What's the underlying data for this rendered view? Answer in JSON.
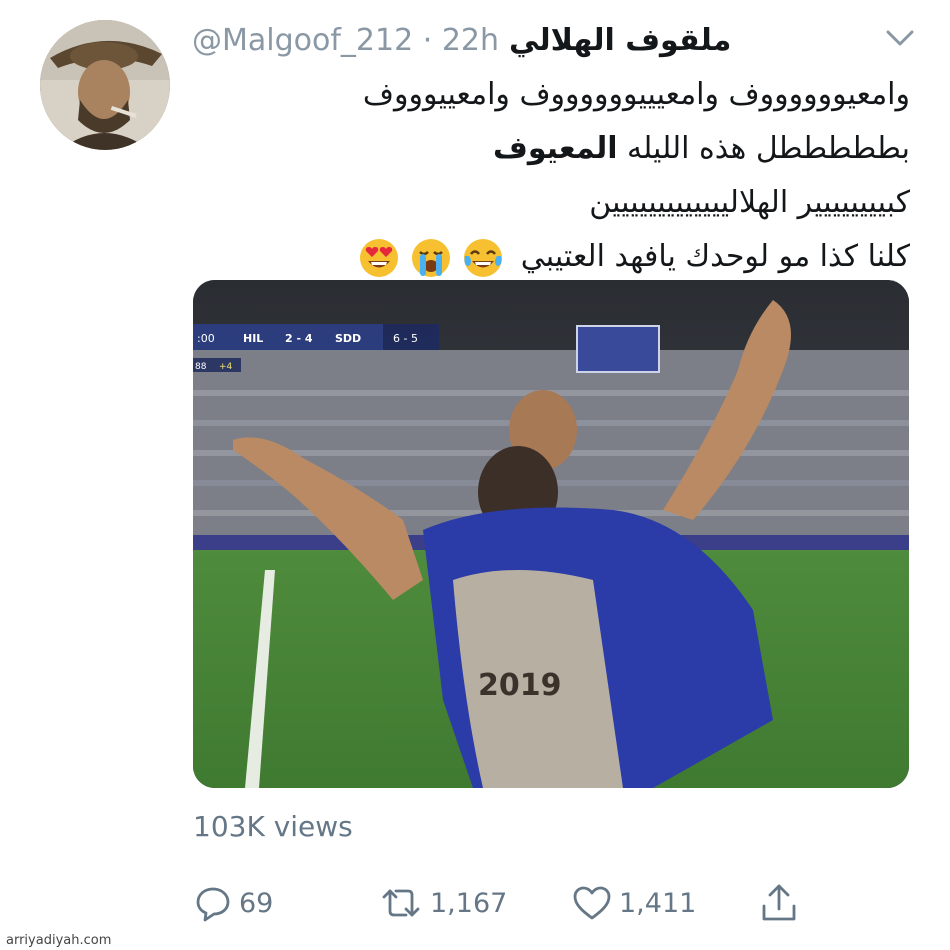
{
  "user": {
    "display_name": "ملقوف الهلالي",
    "handle": "@Malgoof_212",
    "separator": "·",
    "time": "22h"
  },
  "tweet": {
    "line1": "وامعيووووووف وامعيييووووووف وامعييوووف",
    "line2_regular": "بطططططل هذه الليله ",
    "line2_bold": "المعيوف",
    "line3": "كبيييييييير الهلالييييييييييييين",
    "line4": "كلنا كذا مو لوحدك يافهد العتيبي",
    "emojis": [
      "face-with-tears-of-joy",
      "loudly-crying-face",
      "heart-eyes-face"
    ]
  },
  "media": {
    "scoreboard": {
      "clock": ":00",
      "home": "HIL",
      "score": "2 - 4",
      "away": "SDD",
      "aggregate": "6 - 5",
      "extra_left": "88",
      "extra_right": "+4"
    },
    "shirt_text": "2019"
  },
  "stats": {
    "views": "103K views",
    "replies": "69",
    "retweets": "1,167",
    "likes": "1,411"
  },
  "watermark": "arriyadiyah.com"
}
